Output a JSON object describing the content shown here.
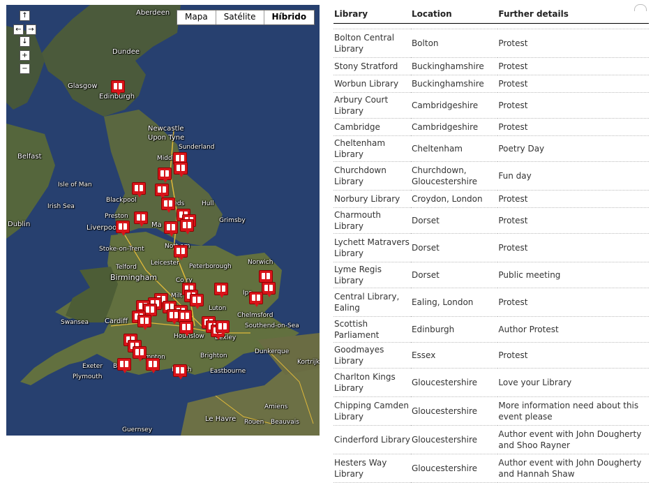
{
  "map": {
    "maptypes": [
      "Mapa",
      "Satélite",
      "Híbrido"
    ],
    "selected_maptype": "Híbrido",
    "controls": {
      "up": "↑",
      "left": "←",
      "right": "→",
      "down": "↓",
      "zoom_in": "+",
      "zoom_out": "−"
    },
    "places": {
      "aberdeen": "Aberdeen",
      "dundee": "Dundee",
      "glasgow": "Glasgow",
      "edinburgh": "Edinburgh",
      "newcastle": "Newcastle\nUpon Tyne",
      "sunderland": "Sunderland",
      "middlesbrough": "Middl",
      "belfast": "Belfast",
      "isle_of_man": "Isle of Man",
      "blackpool": "Blackpool",
      "leeds": "Leeds",
      "hull": "Hull",
      "irish_sea": "Irish Sea",
      "preston": "Preston",
      "dublin": "Dublin",
      "liverpool": "Liverpool",
      "manchester": "Ma",
      "grimsby": "Grimsby",
      "stoke": "Stoke-on-Trent",
      "nottingham": "Nott   am",
      "telford": "Telford",
      "leicester": "Leicester",
      "peterborough": "Peterborough",
      "norwich": "Norwich",
      "birmingham": "Birmingham",
      "coventry": "Co    ry",
      "milton": "Milt",
      "ipswich": "Ips",
      "luton": "Luton",
      "swansea": "Swansea",
      "cardiff": "Cardiff",
      "chelmsford": "Chelmsford",
      "southend": "Southend-on-Sea",
      "hounslow": "Hounslow",
      "bexley": "Bexley",
      "brighton": "Brighton",
      "dunkerque": "Dunkerque",
      "kortrijk": "Kortrijk",
      "exeter": "Exeter",
      "bournemouth": "B",
      "southampton": "S    mpton",
      "portsmouth": "P    outh",
      "eastbourne": "Eastbourne",
      "plymouth": "Plymouth",
      "amiens": "Amiens",
      "le_havre": "Le Havre",
      "rouen": "Rouen",
      "beauvais": "Beauvais",
      "guernsey": "Guernsey"
    }
  },
  "table": {
    "headers": [
      "Library",
      "Location",
      "Further details"
    ],
    "rows": [
      [
        "Bolton Central Library",
        "Bolton",
        "Protest"
      ],
      [
        "Stony Stratford",
        "Buckinghamshire",
        "Protest"
      ],
      [
        "Worbun Library",
        "Buckinghamshire",
        "Protest"
      ],
      [
        "Arbury Court Library",
        "Cambridgeshire",
        "Protest"
      ],
      [
        "Cambridge",
        "Cambridgeshire",
        "Protest"
      ],
      [
        "Cheltenham Library",
        "Cheltenham",
        "Poetry Day"
      ],
      [
        "Churchdown Library",
        "Churchdown, Gloucestershire",
        "Fun day"
      ],
      [
        "Norbury Library",
        "Croydon, London",
        "Protest"
      ],
      [
        "Charmouth Library",
        "Dorset",
        "Protest"
      ],
      [
        "Lychett Matravers Library",
        "Dorset",
        "Protest"
      ],
      [
        "Lyme Regis Library",
        "Dorset",
        "Public meeting"
      ],
      [
        "Central Library, Ealing",
        "Ealing, London",
        "Protest"
      ],
      [
        "Scottish Parliament",
        "Edinburgh",
        "Author Protest"
      ],
      [
        "Goodmayes Library",
        "Essex",
        "Protest"
      ],
      [
        "Charlton Kings Library",
        "Gloucestershire",
        "Love your Library"
      ],
      [
        "Chipping Camden Library",
        "Gloucestershire",
        "More information need about this event please"
      ],
      [
        "Cinderford Library",
        "Gloucestershire",
        "Author event with John Dougherty and Shoo Rayner"
      ],
      [
        "Hesters Way Library",
        "Gloucestershire",
        "Author event with John Dougherty and Hannah Shaw"
      ]
    ]
  }
}
